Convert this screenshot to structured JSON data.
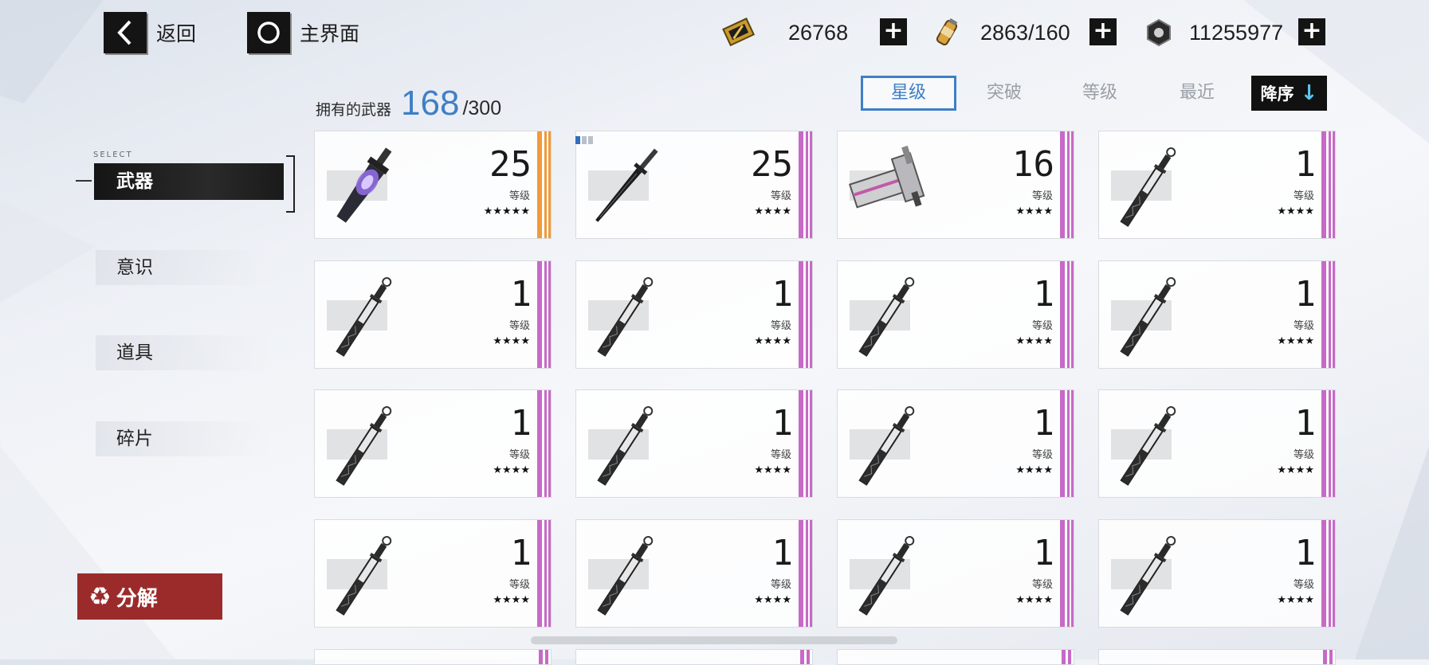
{
  "top": {
    "back_label": "返回",
    "home_label": "主界面"
  },
  "resources": [
    {
      "icon": "gold-ticket-icon",
      "value": "26768"
    },
    {
      "icon": "energy-canister-icon",
      "value": "2863/160"
    },
    {
      "icon": "hex-nut-coin-icon",
      "value": "11255977"
    }
  ],
  "inventory": {
    "label": "拥有的武器",
    "count": "168",
    "max": "/300"
  },
  "sort": {
    "tabs": [
      "星级",
      "突破",
      "等级",
      "最近"
    ],
    "active": "星级",
    "order_label": "降序",
    "order_icon": "arrow-down-icon"
  },
  "sidebar": {
    "select_tag": "SELECT",
    "items": [
      "武器",
      "意识",
      "道具",
      "碎片"
    ],
    "active": "武器"
  },
  "decompose_label": "分解",
  "level_label": "等级",
  "colors": {
    "accent": "#3f7fc6",
    "rarity5": "#f09a3a",
    "rarity4": "#c66ac6",
    "decompose": "#9b2b2b"
  },
  "weapons": [
    {
      "level": "25",
      "stars": "★★★★★",
      "rarity": 5,
      "icon": "purple-greatsword-icon"
    },
    {
      "level": "25",
      "stars": "★★★★",
      "rarity": 4,
      "icon": "black-katana-icon"
    },
    {
      "level": "16",
      "stars": "★★★★",
      "rarity": 4,
      "icon": "cannon-gauntlet-icon"
    },
    {
      "level": "1",
      "stars": "★★★★",
      "rarity": 4,
      "icon": "sheathed-sword-icon"
    },
    {
      "level": "1",
      "stars": "★★★★",
      "rarity": 4,
      "icon": "sheathed-sword-icon"
    },
    {
      "level": "1",
      "stars": "★★★★",
      "rarity": 4,
      "icon": "sheathed-sword-icon"
    },
    {
      "level": "1",
      "stars": "★★★★",
      "rarity": 4,
      "icon": "sheathed-sword-icon"
    },
    {
      "level": "1",
      "stars": "★★★★",
      "rarity": 4,
      "icon": "sheathed-sword-icon"
    },
    {
      "level": "1",
      "stars": "★★★★",
      "rarity": 4,
      "icon": "sheathed-sword-icon"
    },
    {
      "level": "1",
      "stars": "★★★★",
      "rarity": 4,
      "icon": "sheathed-sword-icon"
    },
    {
      "level": "1",
      "stars": "★★★★",
      "rarity": 4,
      "icon": "sheathed-sword-icon"
    },
    {
      "level": "1",
      "stars": "★★★★",
      "rarity": 4,
      "icon": "sheathed-sword-icon"
    },
    {
      "level": "1",
      "stars": "★★★★",
      "rarity": 4,
      "icon": "sheathed-sword-icon"
    },
    {
      "level": "1",
      "stars": "★★★★",
      "rarity": 4,
      "icon": "sheathed-sword-icon"
    },
    {
      "level": "1",
      "stars": "★★★★",
      "rarity": 4,
      "icon": "sheathed-sword-icon"
    },
    {
      "level": "1",
      "stars": "★★★★",
      "rarity": 4,
      "icon": "sheathed-sword-icon"
    }
  ]
}
